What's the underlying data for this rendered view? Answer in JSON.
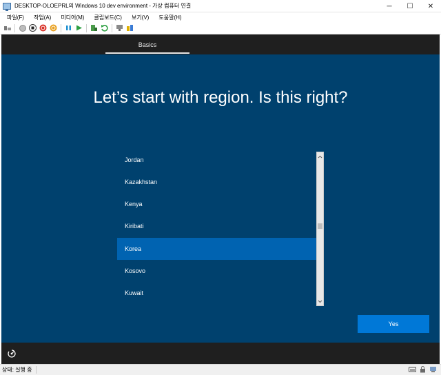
{
  "window": {
    "title": "DESKTOP-OLOEPRL의 Windows 10 dev environment - 가상 컴퓨터 연결",
    "controls": {
      "minimize": "─",
      "maximize": "☐",
      "close": "✕"
    }
  },
  "menu": [
    {
      "label": "파일(F)"
    },
    {
      "label": "작업(A)"
    },
    {
      "label": "미디어(M)"
    },
    {
      "label": "클립보드(C)"
    },
    {
      "label": "보기(V)"
    },
    {
      "label": "도움말(H)"
    }
  ],
  "toolbar": {
    "icons": [
      "ctrl-alt-del-icon",
      "start-icon",
      "turn-off-icon",
      "shut-down-icon",
      "save-icon",
      "pause-icon",
      "resume-icon",
      "checkpoint-icon",
      "revert-icon",
      "enhanced-session-icon",
      "share-icon"
    ]
  },
  "vm": {
    "tab": "Basics",
    "heading": "Let’s start with region. Is this right?",
    "regions": [
      "Jordan",
      "Kazakhstan",
      "Kenya",
      "Kiribati",
      "Korea",
      "Kosovo",
      "Kuwait"
    ],
    "selected_region": "Korea",
    "yes_button": "Yes",
    "colors": {
      "background": "#00416e",
      "selected": "#0063b1",
      "button": "#0078d7",
      "bar": "#1f1f1f"
    }
  },
  "status": {
    "text": "상태: 실행 중"
  }
}
